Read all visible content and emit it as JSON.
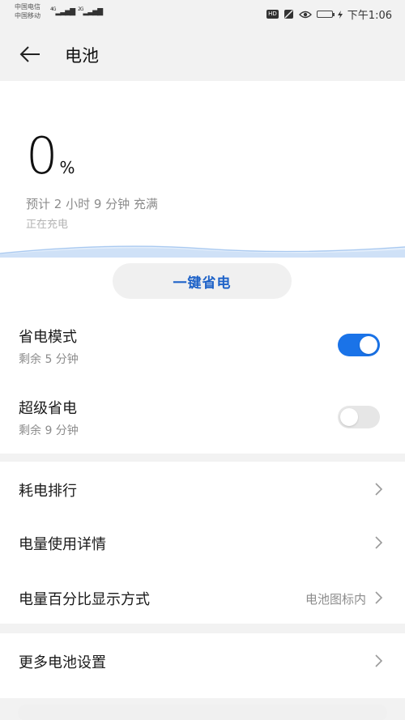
{
  "status": {
    "carrier1": "中国电信",
    "carrier2": "中国移动",
    "sig1_tag": "4G",
    "sig2_tag": "2G",
    "hd": "HD",
    "time": "下午1:06"
  },
  "header": {
    "title": "电池"
  },
  "battery": {
    "percent": "0",
    "percent_symbol": "%",
    "estimate": "预计 2 小时 9 分钟 充满",
    "charging": "正在充电"
  },
  "one_key_save": "一键省电",
  "power_save": {
    "title": "省电模式",
    "sub": "剩余 5 分钟",
    "enabled": true
  },
  "super_save": {
    "title": "超级省电",
    "sub": "剩余 9 分钟",
    "enabled": false
  },
  "list": {
    "ranking": "耗电排行",
    "details": "电量使用详情",
    "percent_display": "电量百分比显示方式",
    "percent_display_value": "电池图标内",
    "more": "更多电池设置"
  },
  "colors": {
    "accent": "#1a73e8",
    "link": "#1f63c8"
  }
}
